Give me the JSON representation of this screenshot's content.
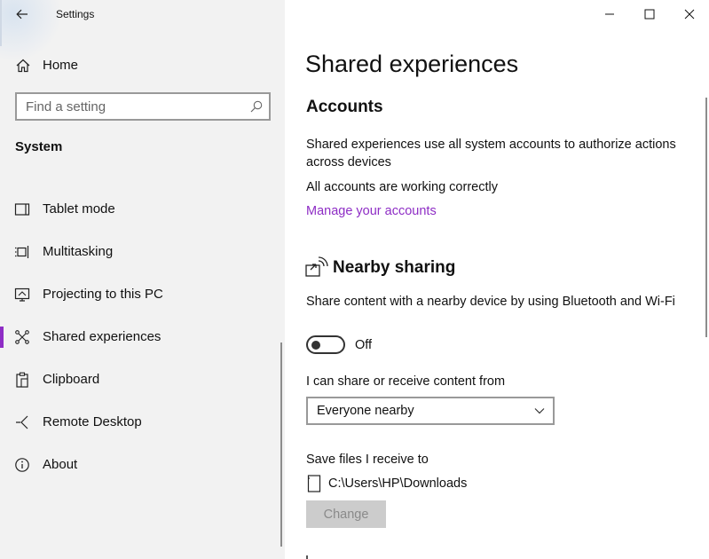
{
  "window": {
    "title": "Settings",
    "controls": {
      "minimize_icon": "minimize-icon",
      "maximize_icon": "maximize-icon",
      "close_icon": "close-icon"
    }
  },
  "sidebar": {
    "back_icon": "back-arrow-icon",
    "home": {
      "label": "Home",
      "icon": "home-icon"
    },
    "search": {
      "placeholder": "Find a setting",
      "value": "",
      "icon": "search-icon"
    },
    "section_header": "System",
    "items": [
      {
        "label": "Tablet mode",
        "icon": "tablet-mode-icon",
        "selected": false
      },
      {
        "label": "Multitasking",
        "icon": "multitasking-icon",
        "selected": false
      },
      {
        "label": "Projecting to this PC",
        "icon": "projecting-icon",
        "selected": false
      },
      {
        "label": "Shared experiences",
        "icon": "shared-experiences-icon",
        "selected": true
      },
      {
        "label": "Clipboard",
        "icon": "clipboard-icon",
        "selected": false
      },
      {
        "label": "Remote Desktop",
        "icon": "remote-desktop-icon",
        "selected": false
      },
      {
        "label": "About",
        "icon": "about-icon",
        "selected": false
      }
    ],
    "accent_color": "#8e2dc5"
  },
  "main": {
    "page_title": "Shared experiences",
    "accounts": {
      "title": "Accounts",
      "description": "Shared experiences use all system accounts to authorize actions across devices",
      "status": "All accounts are working correctly",
      "link": "Manage your accounts"
    },
    "nearby": {
      "title": "Nearby sharing",
      "icon": "nearby-sharing-icon",
      "description": "Share content with a nearby device by using Bluetooth and Wi-Fi",
      "toggle": {
        "state": "Off",
        "on": false
      },
      "share_label": "I can share or receive content from",
      "dropdown": {
        "value": "Everyone nearby",
        "icon": "chevron-down-icon"
      },
      "save_label": "Save files I receive to",
      "save_path": "C:\\Users\\HP\\Downloads",
      "file_icon": "device-icon",
      "change_button": "Change"
    }
  }
}
